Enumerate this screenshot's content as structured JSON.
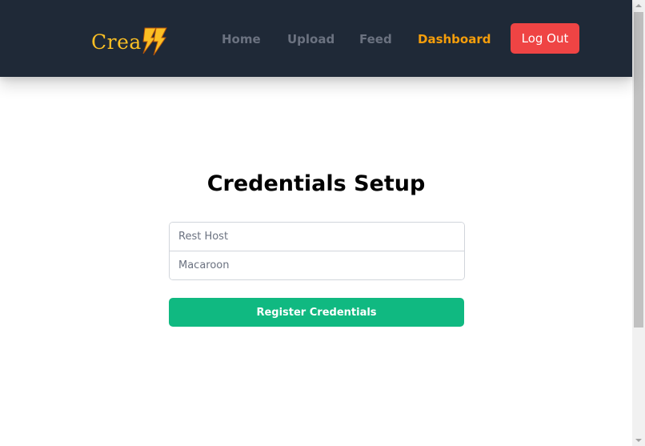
{
  "app": {
    "logo_text": "Crea",
    "logo_icon": "lightning-bolts-icon"
  },
  "nav": {
    "items": [
      {
        "label": "Home",
        "active": false
      },
      {
        "label": "Upload",
        "active": false
      },
      {
        "label": "Feed",
        "active": false
      },
      {
        "label": "Dashboard",
        "active": true
      }
    ],
    "logout_label": "Log Out"
  },
  "form": {
    "title": "Credentials Setup",
    "rest_host": {
      "placeholder": "Rest Host",
      "value": ""
    },
    "macaroon": {
      "placeholder": "Macaroon",
      "value": ""
    },
    "submit_label": "Register Credentials"
  },
  "colors": {
    "navbar_bg": "#1f2937",
    "nav_inactive": "#6b7280",
    "nav_active": "#f59e0b",
    "logo": "#fbbf24",
    "logout_bg": "#ef4444",
    "submit_bg": "#10b981"
  }
}
